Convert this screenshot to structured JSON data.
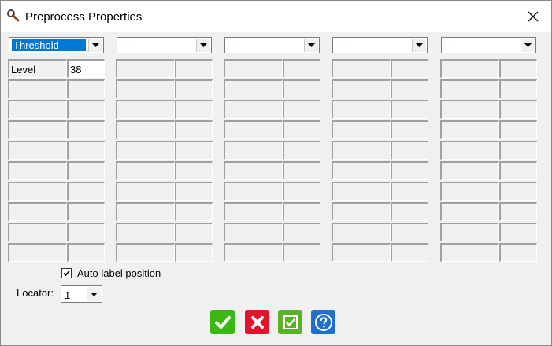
{
  "window": {
    "title": "Preprocess Properties"
  },
  "columns": [
    {
      "selected": "Threshold",
      "rows": [
        {
          "name": "Level",
          "value": "38"
        }
      ]
    },
    {
      "selected": "---",
      "rows": []
    },
    {
      "selected": "---",
      "rows": []
    },
    {
      "selected": "---",
      "rows": []
    },
    {
      "selected": "---",
      "rows": []
    }
  ],
  "auto_label": {
    "label": "Auto label position",
    "checked": true
  },
  "locator": {
    "label": "Locator:",
    "value": "1"
  },
  "buttons": [
    {
      "name": "ok",
      "icon": "checkmark-icon",
      "color": "#3cb815"
    },
    {
      "name": "cancel",
      "icon": "cross-icon",
      "color": "#e2132a"
    },
    {
      "name": "apply",
      "icon": "checkbox-check-icon",
      "color": "#5bb324"
    },
    {
      "name": "help",
      "icon": "question-icon",
      "color": "#1f6fd1"
    }
  ]
}
